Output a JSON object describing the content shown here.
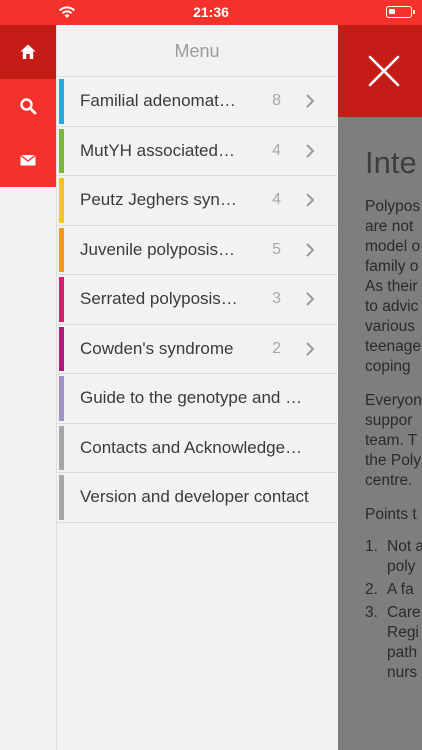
{
  "status": {
    "time": "21:36"
  },
  "menu": {
    "title": "Menu",
    "items": [
      {
        "label": "Familial adenomat…",
        "count": "8",
        "color": "#29a8e0",
        "has_chevron": true
      },
      {
        "label": "MutYH associated…",
        "count": "4",
        "color": "#7bb83b",
        "has_chevron": true
      },
      {
        "label": "Peutz Jeghers syn…",
        "count": "4",
        "color": "#f3c81a",
        "has_chevron": true
      },
      {
        "label": "Juvenile polyposis…",
        "count": "5",
        "color": "#f39a1e",
        "has_chevron": true
      },
      {
        "label": "Serrated polyposis…",
        "count": "3",
        "color": "#e5176f",
        "has_chevron": true
      },
      {
        "label": "Cowden's syndrome",
        "count": "2",
        "color": "#b0197e",
        "has_chevron": true
      },
      {
        "label": "Guide to the genotype and …",
        "count": "",
        "color": "#9f90c8",
        "has_chevron": false
      },
      {
        "label": "Contacts and Acknowledge…",
        "count": "",
        "color": "#a6a6a6",
        "has_chevron": false
      },
      {
        "label": "Version and developer contact",
        "count": "",
        "color": "#a6a6a6",
        "has_chevron": false
      }
    ]
  },
  "content": {
    "heading": "Inte",
    "para1": [
      "Polypos",
      "are not",
      "model o",
      "family o",
      "As their",
      "to advic",
      "various",
      "teenage",
      "coping"
    ],
    "para2": [
      "Everyon",
      "suppor",
      "team. T",
      "the Poly",
      "centre."
    ],
    "points_intro": "Points t",
    "points": [
      {
        "num": "1.",
        "lines": [
          "Not a",
          "poly"
        ]
      },
      {
        "num": "2.",
        "lines": [
          "A fa"
        ]
      },
      {
        "num": "3.",
        "lines": [
          "Care",
          "Regi",
          "path",
          "nurs"
        ]
      }
    ]
  },
  "colors": {
    "brand_red": "#f4312a",
    "dark_red": "#c41c17",
    "overlay_gray": "#7e7e7e"
  },
  "icons": {
    "rail": [
      "home-icon",
      "search-icon",
      "mail-icon"
    ],
    "close": "close-icon",
    "chevron": "chevron-right-icon",
    "wifi": "wifi-icon",
    "battery": "battery-icon"
  }
}
